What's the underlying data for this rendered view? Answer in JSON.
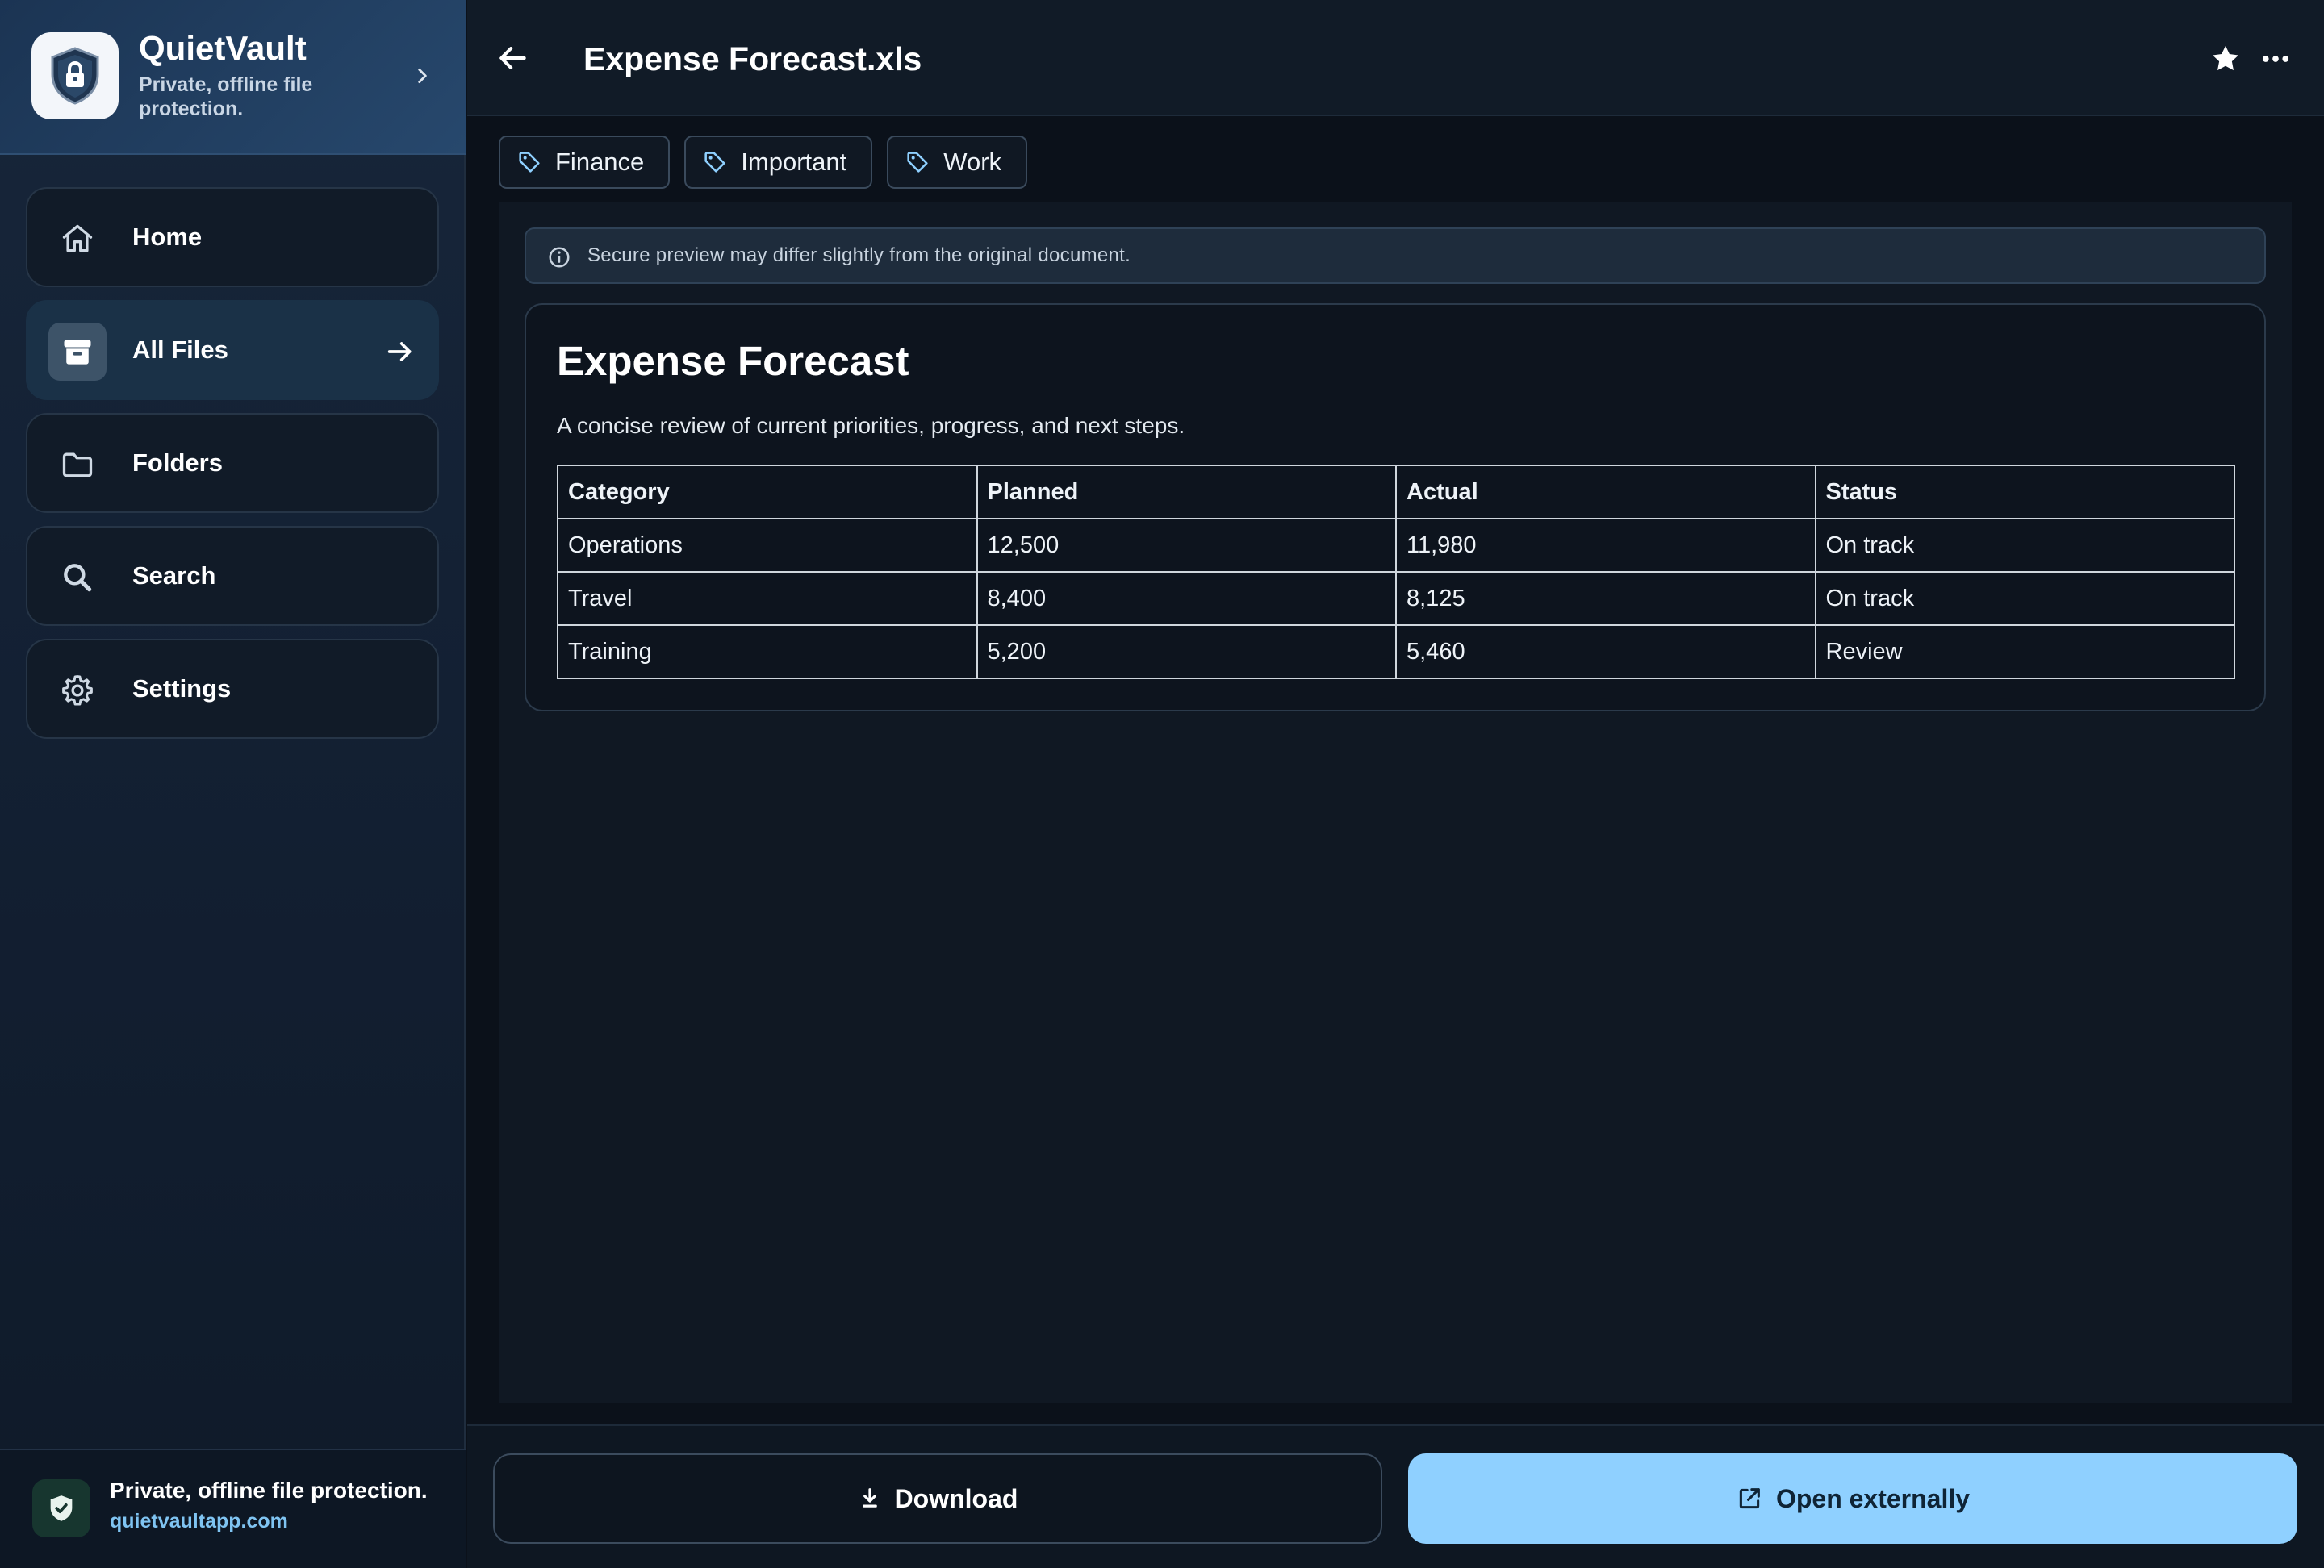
{
  "brand": {
    "name": "QuietVault",
    "tagline": "Private, offline file protection."
  },
  "sidebar": {
    "items": [
      {
        "label": "Home",
        "icon": "home-icon",
        "active": false
      },
      {
        "label": "All Files",
        "icon": "archive-icon",
        "active": true
      },
      {
        "label": "Folders",
        "icon": "folder-icon",
        "active": false
      },
      {
        "label": "Search",
        "icon": "search-icon",
        "active": false
      },
      {
        "label": "Settings",
        "icon": "gear-icon",
        "active": false
      }
    ],
    "footer": {
      "text": "Private, offline file protection.",
      "link": "quietvaultapp.com"
    }
  },
  "header": {
    "file_name": "Expense Forecast.xls"
  },
  "tags": [
    {
      "label": "Finance"
    },
    {
      "label": "Important"
    },
    {
      "label": "Work"
    }
  ],
  "preview": {
    "notice": "Secure preview may differ slightly from the original document.",
    "document": {
      "title": "Expense Forecast",
      "description": "A concise review of current priorities, progress, and next steps.",
      "columns": [
        "Category",
        "Planned",
        "Actual",
        "Status"
      ],
      "rows": [
        [
          "Operations",
          "12,500",
          "11,980",
          "On track"
        ],
        [
          "Travel",
          "8,400",
          "8,125",
          "On track"
        ],
        [
          "Training",
          "5,200",
          "5,460",
          "Review"
        ]
      ]
    }
  },
  "actions": {
    "download_label": "Download",
    "open_label": "Open externally"
  },
  "colors": {
    "accent": "#8fd0ff",
    "link": "#7fc4f2",
    "background": "#0b111a"
  }
}
